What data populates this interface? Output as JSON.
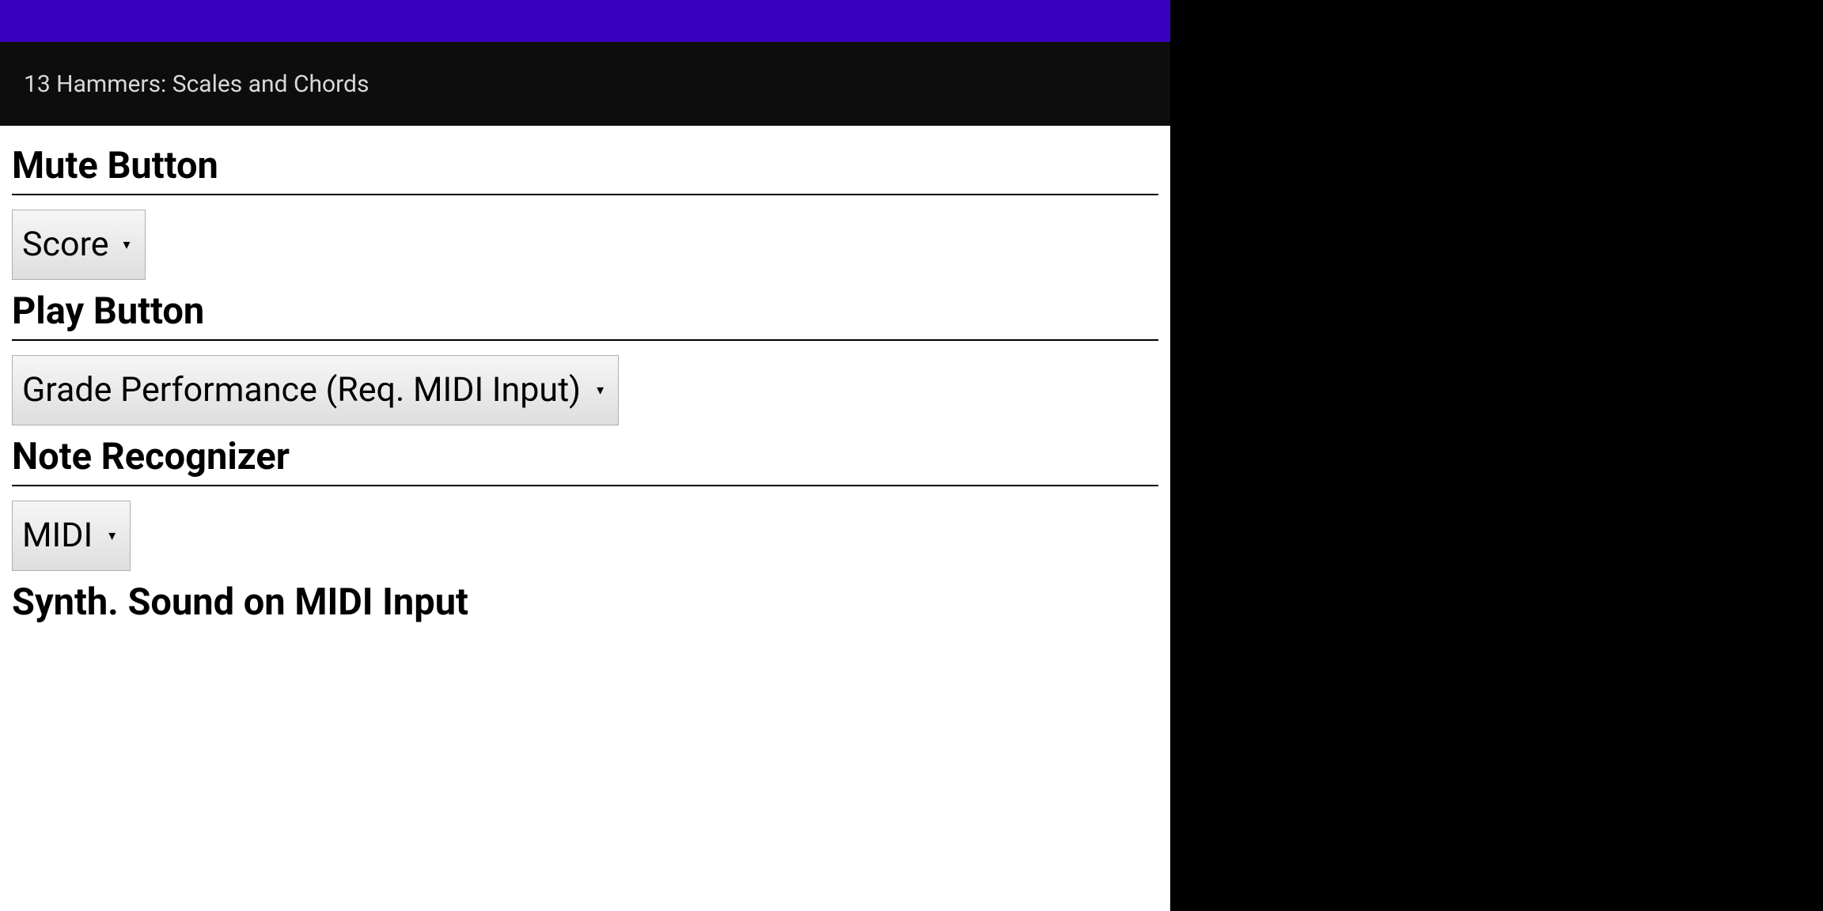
{
  "header": {
    "title": "13 Hammers: Scales and Chords"
  },
  "sections": [
    {
      "heading": "Mute Button",
      "select_value": "Score"
    },
    {
      "heading": "Play Button",
      "select_value": "Grade Performance (Req. MIDI Input)"
    },
    {
      "heading": "Note Recognizer",
      "select_value": "MIDI"
    },
    {
      "heading": "Synth. Sound on MIDI Input"
    }
  ]
}
